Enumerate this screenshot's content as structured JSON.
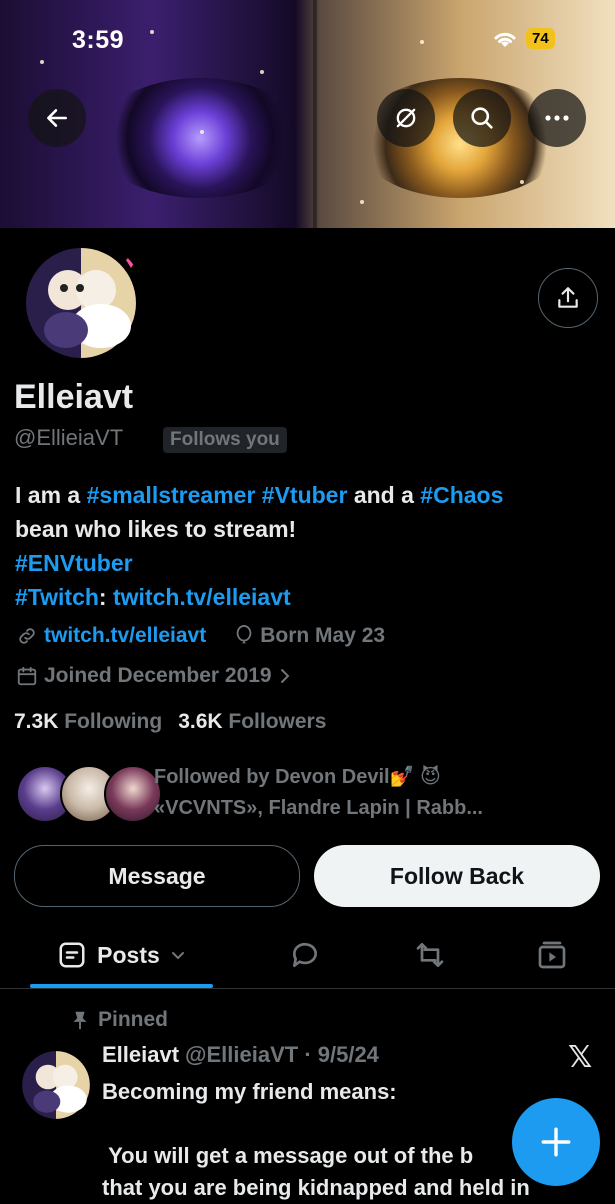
{
  "status_bar": {
    "time": "3:59",
    "battery": "74"
  },
  "banner": {
    "back_icon": "arrow-left-icon",
    "hide_icon": "eye-slash-icon",
    "search_icon": "search-icon",
    "more_icon": "more-horizontal-icon"
  },
  "profile": {
    "name": "Elleiavt",
    "handle": "@EllieiaVT",
    "follows_you": "Follows you",
    "bio": {
      "line1_pre": "I am a ",
      "tag1": "#smallstreamer",
      "tag2": "#Vtuber",
      "line1_mid": " and a ",
      "tag3": "#Chaos",
      "line2": "bean who likes to stream!",
      "tag4": "#ENVtuber",
      "tag5": "#Twitch",
      "line4_mid": ": ",
      "bio_link": "twitch.tv/elleiavt"
    },
    "website": "twitch.tv/elleiavt",
    "birthday": "Born May 23",
    "joined": "Joined December 2019",
    "following_count": "7.3K",
    "following_label": "Following",
    "followers_count": "3.6K",
    "followers_label": "Followers",
    "followed_by_line1": "Followed by Devon Devil💅 😈",
    "followed_by_line2": "«VCVNTS», Flandre Lapin | Rabb..."
  },
  "actions": {
    "message": "Message",
    "follow_back": "Follow Back"
  },
  "tabs": {
    "posts": "Posts"
  },
  "post": {
    "pinned": "Pinned",
    "name": "Elleiavt",
    "handle_date": "@EllieiaVT · 9/5/24",
    "body": "Becoming my friend means:\n\n You will get a message out of the b\nthat you are being kidnapped and held in"
  },
  "colors": {
    "accent": "#1d9bf0",
    "muted": "#71767b",
    "battery": "#f3c21a"
  }
}
